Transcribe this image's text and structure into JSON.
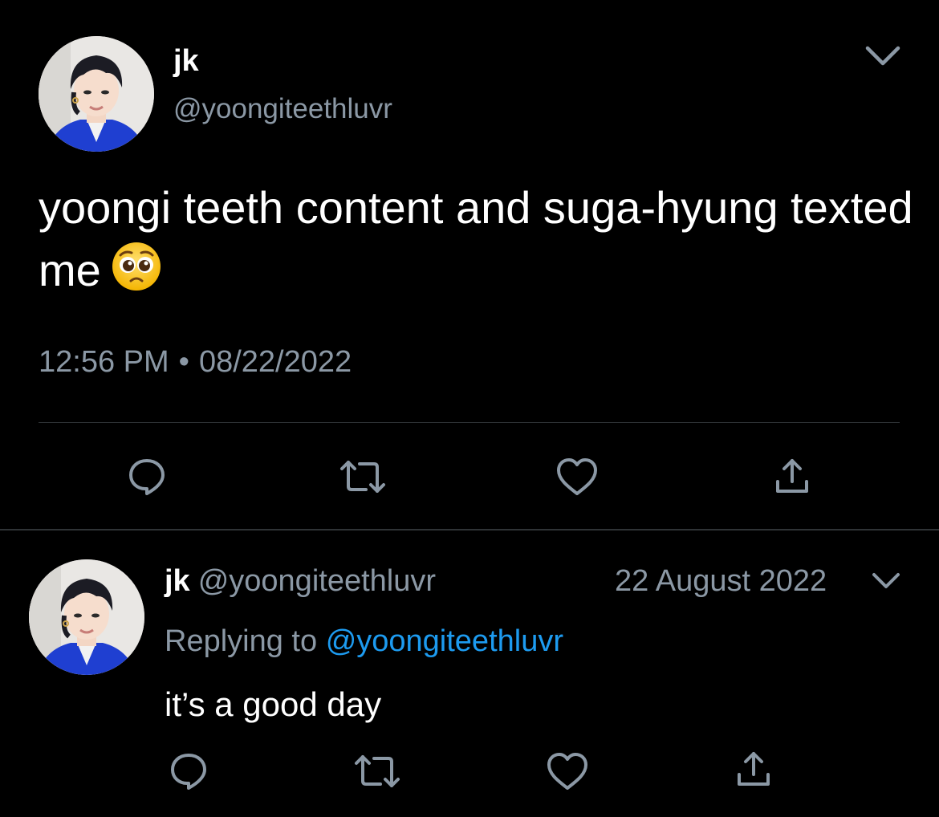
{
  "main_tweet": {
    "author_name": "jk",
    "handle": "@yoongiteethluvr",
    "text": "yoongi teeth content and suga-hyung texted me",
    "emoji_icon": "pleading-face-icon",
    "time": "12:56 PM",
    "date": "08/22/2022",
    "separator": "•"
  },
  "reply_tweet": {
    "author_name": "jk",
    "handle": "@yoongiteethluvr",
    "date": "22 August 2022",
    "replying_prefix": "Replying to",
    "replying_to": "@yoongiteethluvr",
    "text": "it’s a good day"
  },
  "actions": [
    "reply-icon",
    "retweet-icon",
    "like-icon",
    "share-icon"
  ],
  "colors": {
    "background": "#000000",
    "primary_text": "#ffffff",
    "secondary_text": "#8b98a5",
    "link": "#1d9bf0",
    "divider": "#2f3336"
  }
}
